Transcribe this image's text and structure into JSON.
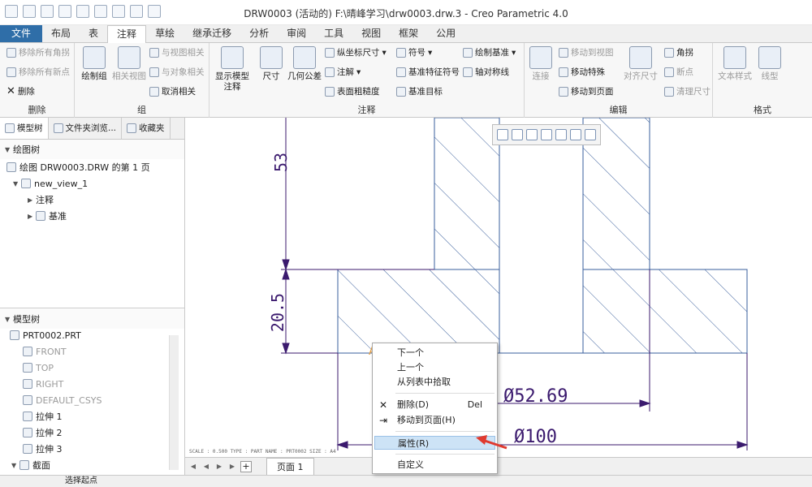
{
  "window": {
    "title": "DRW0003 (活动的) F:\\晴峰学习\\drw0003.drw.3 - Creo Parametric 4.0"
  },
  "menu": {
    "tabs": [
      "文件",
      "布局",
      "表",
      "注释",
      "草绘",
      "继承迁移",
      "分析",
      "审阅",
      "工具",
      "视图",
      "框架",
      "公用"
    ],
    "active": "注释"
  },
  "ribbon": {
    "delete_group": {
      "items": [
        "移除所有角拐",
        "移除所有新点",
        "删除"
      ],
      "label": "删除"
    },
    "group_group": {
      "big": [
        "绘制组",
        "相关视图"
      ],
      "items": [
        "与视图相关",
        "与对象相关",
        "取消相关"
      ],
      "label": "组"
    },
    "annot_group": {
      "big": [
        "显示模型注释",
        "尺寸",
        "几何公差"
      ],
      "col1": [
        "纵坐标尺寸",
        "注解",
        "表面粗糙度"
      ],
      "col2": [
        "符号",
        "基准特征符号",
        "基准目标"
      ],
      "col3": [
        "绘制基准",
        "轴对称线"
      ],
      "label": "注释"
    },
    "edit_group": {
      "items": [
        "连接",
        "移动到视图",
        "移动特殊",
        "移动到页面",
        "对齐尺寸",
        "角拐",
        "断点",
        "清理尺寸"
      ],
      "label": "编辑"
    },
    "format_group": {
      "items": [
        "文本样式",
        "线型"
      ],
      "label": "格式"
    }
  },
  "left_panel": {
    "tabs": [
      "模型树",
      "文件夹浏览...",
      "收藏夹"
    ],
    "drawing_tree": {
      "title": "绘图树",
      "page": "绘图 DRW0003.DRW 的第 1 页",
      "view": "new_view_1",
      "children": [
        "注释",
        "基准"
      ]
    },
    "model_tree": {
      "title": "模型树",
      "part": "PRT0002.PRT",
      "items": [
        "FRONT",
        "TOP",
        "RIGHT",
        "DEFAULT_CSYS",
        "拉伸 1",
        "拉伸 2",
        "拉伸 3",
        "截面"
      ]
    }
  },
  "drawing": {
    "dims": [
      "53",
      "20.5",
      "Ø52.69",
      "Ø100"
    ],
    "footer": "SCALE : 0.500   TYPE : PART   NAME : PRT0002   SIZE : A4"
  },
  "context_menu": {
    "items": [
      "下一个",
      "上一个",
      "从列表中拾取",
      "删除(D)",
      "移动到页面(H)",
      "属性(R)",
      "自定义"
    ],
    "shortcut": "Del",
    "highlighted": "属性(R)"
  },
  "sheet": {
    "tab": "页面 1"
  },
  "status": {
    "text": "选择起点"
  },
  "colors": {
    "drawing_line": "#3a5f9c",
    "dimension": "#3b1a6e",
    "arrow_red": "#e03a2f",
    "file_tab": "#2f6ea8"
  }
}
